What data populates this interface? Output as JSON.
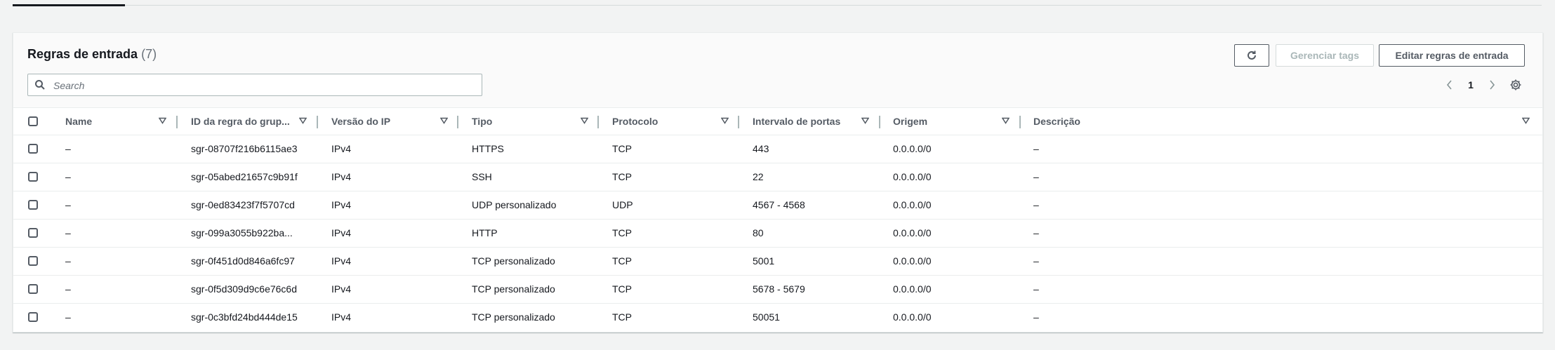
{
  "table": {
    "title": "Regras de entrada",
    "count": "(7)",
    "search_placeholder": "Search",
    "buttons": {
      "refresh_icon": "refresh-icon",
      "manage_tags": "Gerenciar tags",
      "edit_rules": "Editar regras de entrada"
    },
    "pagination": {
      "current_page": "1"
    },
    "columns": [
      "Name",
      "ID da regra do grup...",
      "Versão do IP",
      "Tipo",
      "Protocolo",
      "Intervalo de portas",
      "Origem",
      "Descrição"
    ],
    "rows": [
      {
        "name": "–",
        "rule_id": "sgr-08707f216b6115ae3",
        "ip_version": "IPv4",
        "type": "HTTPS",
        "protocol": "TCP",
        "port_range": "443",
        "source": "0.0.0.0/0",
        "description": "–"
      },
      {
        "name": "–",
        "rule_id": "sgr-05abed21657c9b91f",
        "ip_version": "IPv4",
        "type": "SSH",
        "protocol": "TCP",
        "port_range": "22",
        "source": "0.0.0.0/0",
        "description": "–"
      },
      {
        "name": "–",
        "rule_id": "sgr-0ed83423f7f5707cd",
        "ip_version": "IPv4",
        "type": "UDP personalizado",
        "protocol": "UDP",
        "port_range": "4567 - 4568",
        "source": "0.0.0.0/0",
        "description": "–"
      },
      {
        "name": "–",
        "rule_id": "sgr-099a3055b922ba...",
        "ip_version": "IPv4",
        "type": "HTTP",
        "protocol": "TCP",
        "port_range": "80",
        "source": "0.0.0.0/0",
        "description": "–"
      },
      {
        "name": "–",
        "rule_id": "sgr-0f451d0d846a6fc97",
        "ip_version": "IPv4",
        "type": "TCP personalizado",
        "protocol": "TCP",
        "port_range": "5001",
        "source": "0.0.0.0/0",
        "description": "–"
      },
      {
        "name": "–",
        "rule_id": "sgr-0f5d309d9c6e76c6d",
        "ip_version": "IPv4",
        "type": "TCP personalizado",
        "protocol": "TCP",
        "port_range": "5678 - 5679",
        "source": "0.0.0.0/0",
        "description": "–"
      },
      {
        "name": "–",
        "rule_id": "sgr-0c3bfd24bd444de15",
        "ip_version": "IPv4",
        "type": "TCP personalizado",
        "protocol": "TCP",
        "port_range": "50051",
        "source": "0.0.0.0/0",
        "description": "–"
      }
    ]
  }
}
